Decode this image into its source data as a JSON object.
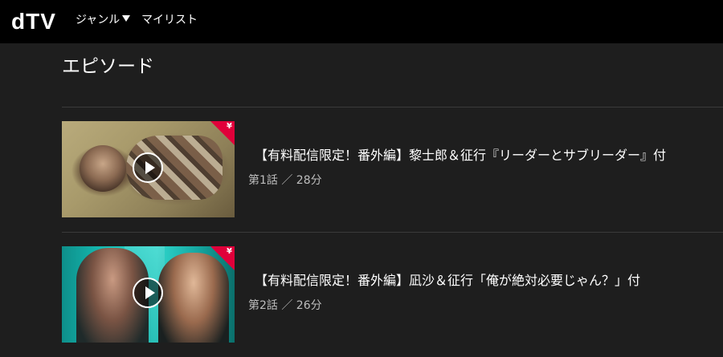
{
  "header": {
    "logo": "dTV",
    "nav": [
      {
        "label": "ジャンル"
      },
      {
        "label": "マイリスト"
      }
    ]
  },
  "section": {
    "title": "エピソード"
  },
  "colors": {
    "header_bg": "#000000",
    "page_bg": "#1e1e1e",
    "paid_badge": "#e0003a",
    "meta_text": "#bdbdbd"
  },
  "episodes": [
    {
      "title": "【有料配信限定！番外編】黎士郎＆征行『リーダーとサブリーダー』付",
      "meta": "第1話 ／ 28分",
      "badge": "¥",
      "icon": "play-icon"
    },
    {
      "title": "【有料配信限定！番外編】凪沙＆征行「俺が絶対必要じゃん？」付",
      "meta": "第2話 ／ 26分",
      "badge": "¥",
      "icon": "play-icon"
    }
  ]
}
